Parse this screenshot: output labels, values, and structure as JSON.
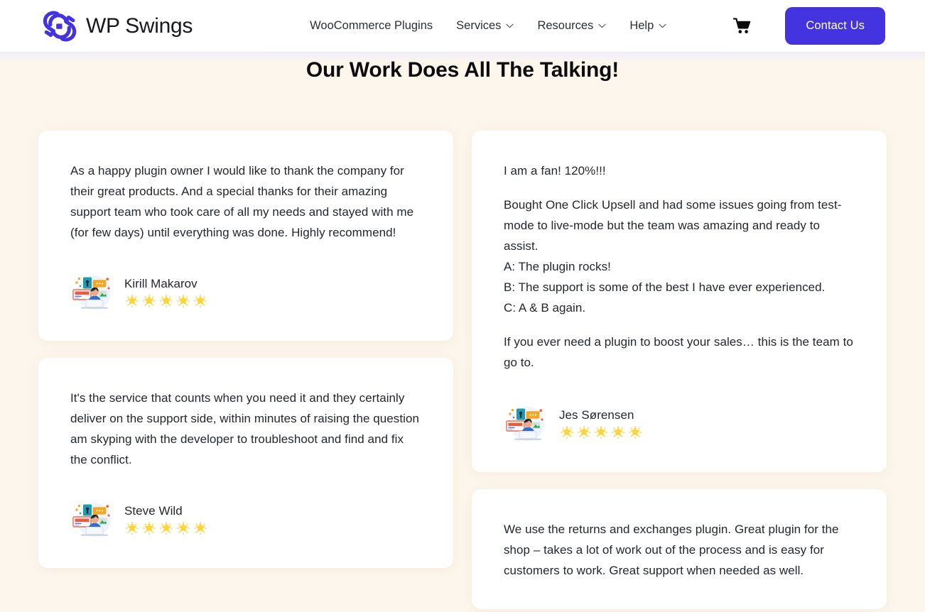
{
  "header": {
    "logo_icon": "wp-swings-logo-icon",
    "brand_name": "WP Swings",
    "brand_color": "#4334e0",
    "nav": [
      {
        "label": "WooCommerce Plugins",
        "has_dropdown": false
      },
      {
        "label": "Services",
        "has_dropdown": true
      },
      {
        "label": "Resources",
        "has_dropdown": true
      },
      {
        "label": "Help",
        "has_dropdown": true
      }
    ],
    "cart_icon": "shopping-cart-icon",
    "contact_label": "Contact Us"
  },
  "page": {
    "title": "Our Work Does All The Talking!",
    "background_color": "#fdf6ec",
    "card_background": "#ffffff",
    "star_color": "#ffd43b"
  },
  "testimonials": {
    "left": [
      {
        "paragraphs": [
          "As a happy plugin owner I would like to thank the company for their great products. And a special thanks for their amazing support team who took care of all my needs and stayed with me (for few days) until everything was done. Highly recommend!"
        ],
        "author": "Kirill Makarov",
        "avatar_icon": "person-at-laptop-avatar-icon",
        "rating": 5
      },
      {
        "paragraphs": [
          "It's the service that counts when you need it and they certainly deliver on the support side, within minutes of raising the question am skyping with the developer to troubleshoot and find and fix the conflict."
        ],
        "author": "Steve Wild",
        "avatar_icon": "person-at-laptop-avatar-icon",
        "rating": 5
      }
    ],
    "right": [
      {
        "paragraphs": [
          "I am a fan! 120%!!!",
          "Bought One Click Upsell and had some issues going from test-mode to live-mode but the team was amazing and ready to assist.\nA: The plugin rocks!\nB: The support is some of the best I have ever experienced.\nC: A & B again.",
          "If you ever need a plugin to boost your sales… this is the team to go to."
        ],
        "author": "Jes Sørensen",
        "avatar_icon": "person-at-laptop-avatar-icon",
        "rating": 5
      },
      {
        "paragraphs": [
          "We use the returns and exchanges plugin. Great plugin for the shop – takes a lot of work out of the process and is easy for customers to work. Great support when needed as well."
        ],
        "author": "",
        "avatar_icon": "",
        "rating": 0
      }
    ]
  }
}
